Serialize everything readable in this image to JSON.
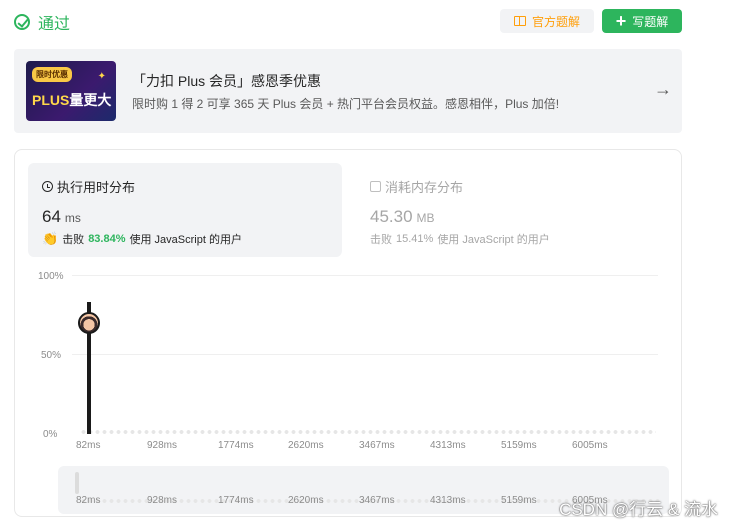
{
  "header": {
    "status": "通过",
    "official_solution": "官方题解",
    "write_solution": "写题解"
  },
  "promo": {
    "tag": "限时优惠",
    "image_text_plus": "PLUS",
    "image_text_rest": "量更大",
    "title": "「力扣 Plus 会员」感恩季优惠",
    "subtitle": "限时购 1 得 2 可享 365 天 Plus 会员 + 热门平台会员权益。感恩相伴，Plus 加倍!"
  },
  "runtime": {
    "title": "执行用时分布",
    "value": "64",
    "unit": "ms",
    "beat_label": "击败",
    "beat_percent": "83.84%",
    "beat_suffix": "使用 JavaScript 的用户"
  },
  "memory": {
    "title": "消耗内存分布",
    "value": "45.30",
    "unit": "MB",
    "beat_label": "击败",
    "beat_percent": "15.41%",
    "beat_suffix": "使用 JavaScript 的用户"
  },
  "chart_data": {
    "type": "bar",
    "yticks": [
      "100%",
      "50%",
      "0%"
    ],
    "xticks": [
      "82ms",
      "928ms",
      "1774ms",
      "2620ms",
      "3467ms",
      "4313ms",
      "5159ms",
      "6005ms"
    ],
    "highlight_bar": {
      "x": "82ms",
      "value_percent": 83
    },
    "current_marker_percent": 70
  },
  "slider_ticks": [
    "82ms",
    "928ms",
    "1774ms",
    "2620ms",
    "3467ms",
    "4313ms",
    "5159ms",
    "6005ms"
  ],
  "watermark": "CSDN @行云 & 流水"
}
